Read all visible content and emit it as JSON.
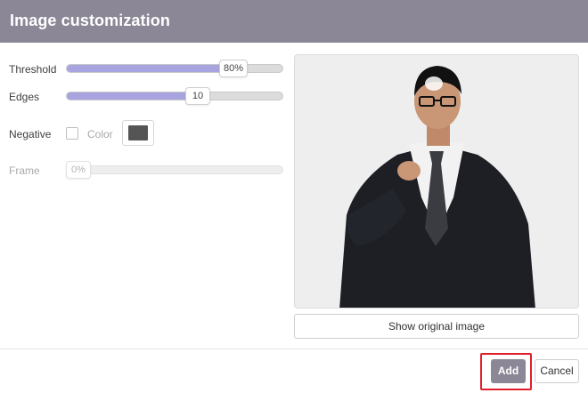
{
  "dialog": {
    "title": "Image customization"
  },
  "controls": {
    "threshold": {
      "label": "Threshold",
      "value": "80%",
      "fraction": 0.8
    },
    "edges": {
      "label": "Edges",
      "value": "10",
      "fraction": 0.55
    },
    "negative": {
      "label": "Negative",
      "checked": false,
      "color_label": "Color",
      "color": "#555555"
    },
    "frame": {
      "label": "Frame",
      "value": "0%",
      "fraction": 0.0,
      "disabled": true
    }
  },
  "preview": {
    "show_original_label": "Show original image"
  },
  "footer": {
    "add_label": "Add",
    "cancel_label": "Cancel"
  },
  "colors": {
    "header": "#8b8796",
    "slider_fill": "#a8a4e0",
    "highlight": "#e0202a"
  }
}
